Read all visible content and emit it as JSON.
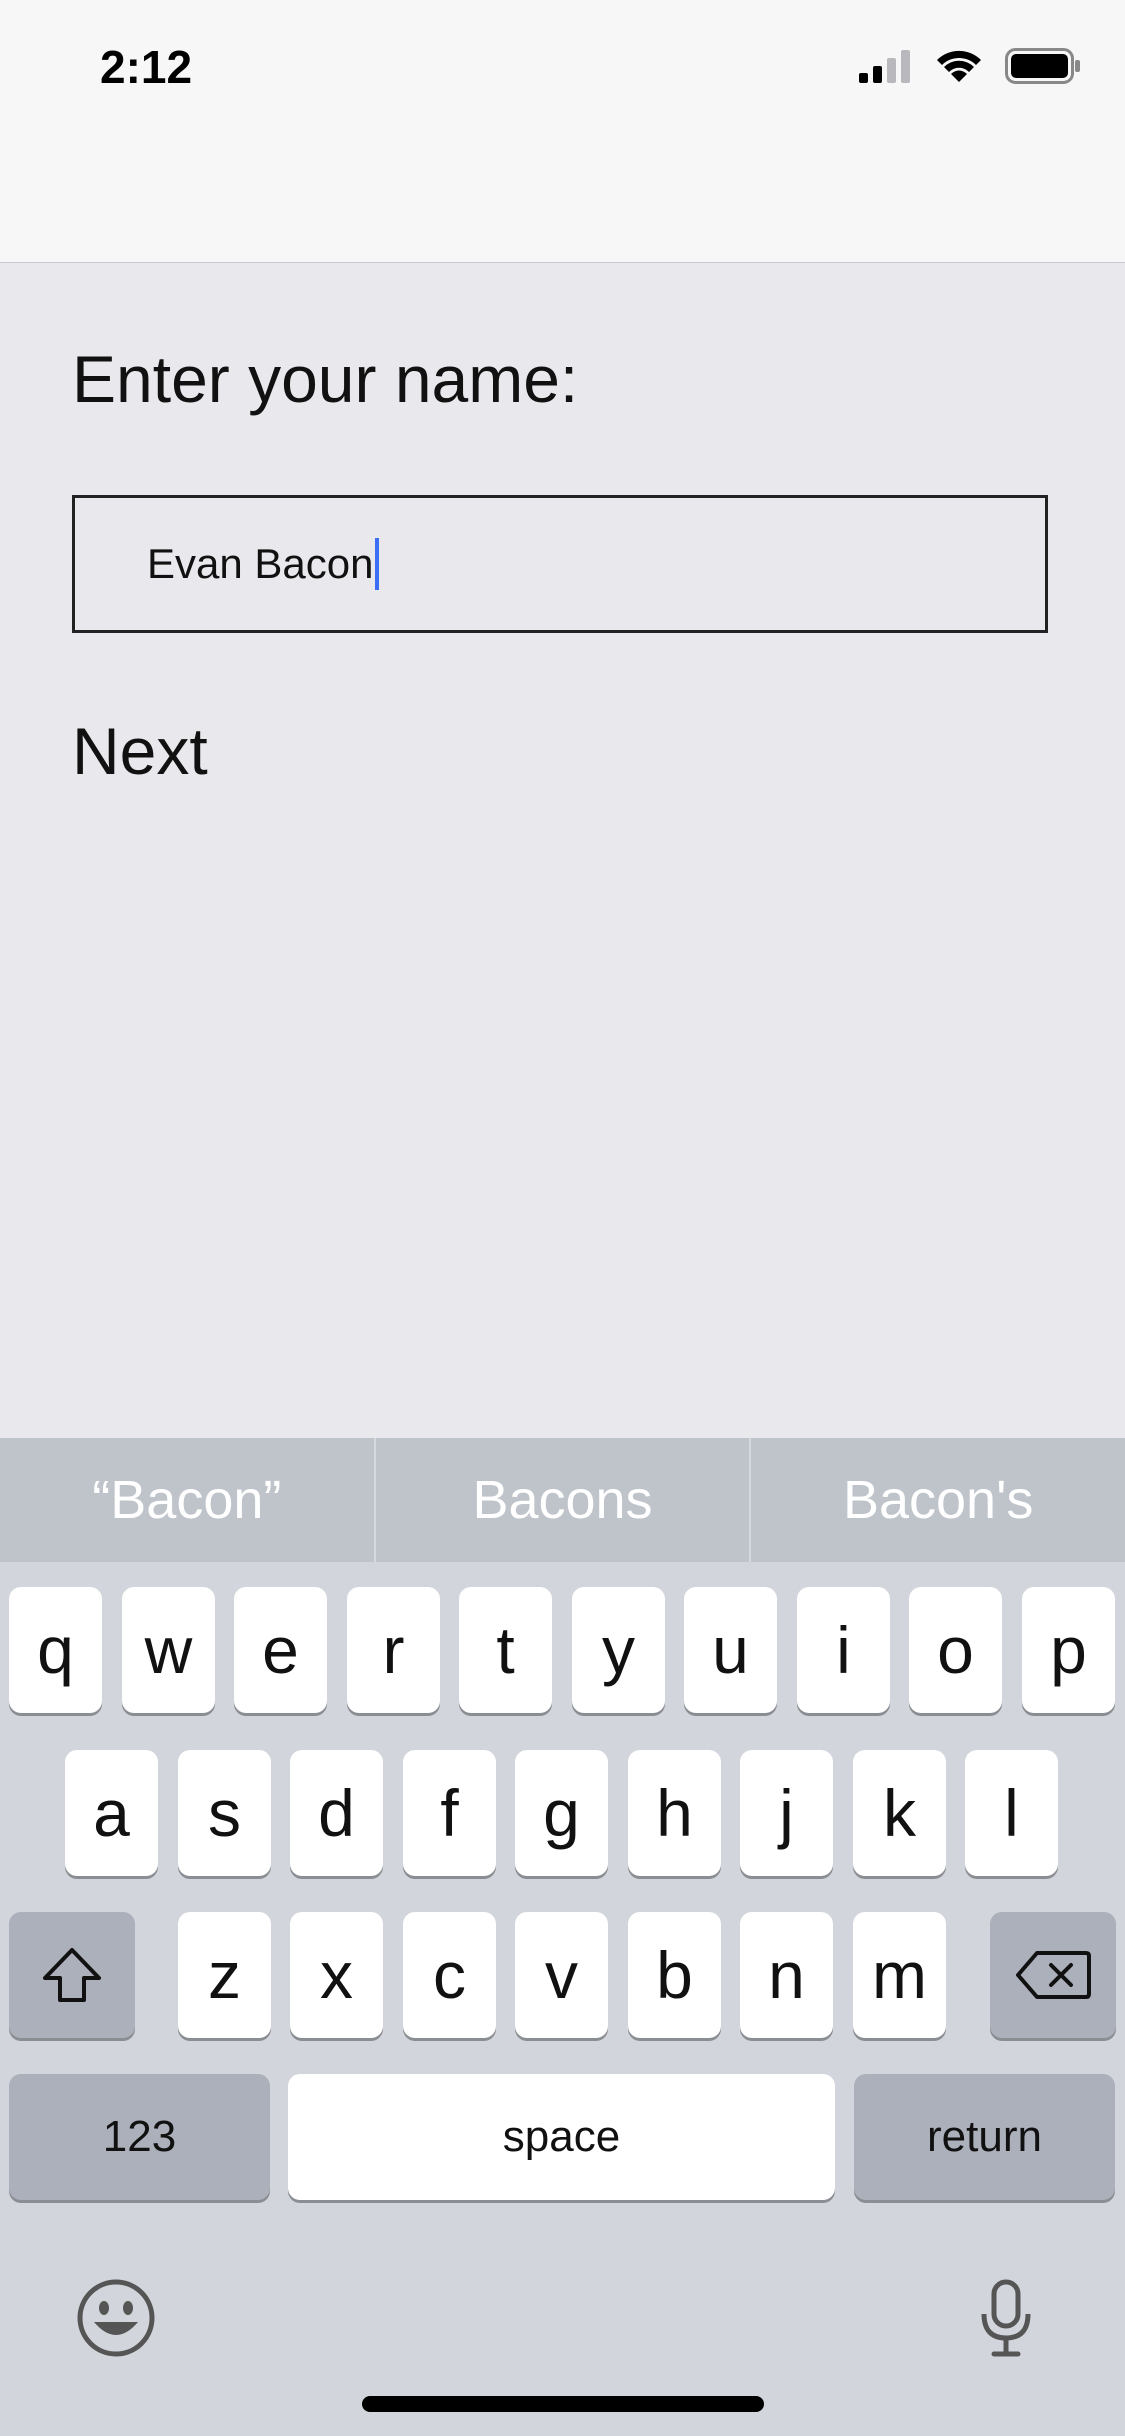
{
  "status_bar": {
    "time": "2:12"
  },
  "form": {
    "prompt": "Enter your name:",
    "name_value": "Evan Bacon",
    "next_label": "Next"
  },
  "keyboard": {
    "suggestions": [
      "“Bacon”",
      "Bacons",
      "Bacon's"
    ],
    "row1": [
      "q",
      "w",
      "e",
      "r",
      "t",
      "y",
      "u",
      "i",
      "o",
      "p"
    ],
    "row2": [
      "a",
      "s",
      "d",
      "f",
      "g",
      "h",
      "j",
      "k",
      "l"
    ],
    "row3": [
      "z",
      "x",
      "c",
      "v",
      "b",
      "n",
      "m"
    ],
    "numbers_label": "123",
    "space_label": "space",
    "return_label": "return",
    "icons": {
      "shift": "shift-icon",
      "delete": "delete-icon",
      "emoji": "emoji-icon",
      "mic": "microphone-icon"
    }
  },
  "colors": {
    "caret": "#3b6ef6",
    "background": "#e9e8ed",
    "keyboard_bg": "#d2d5db"
  }
}
